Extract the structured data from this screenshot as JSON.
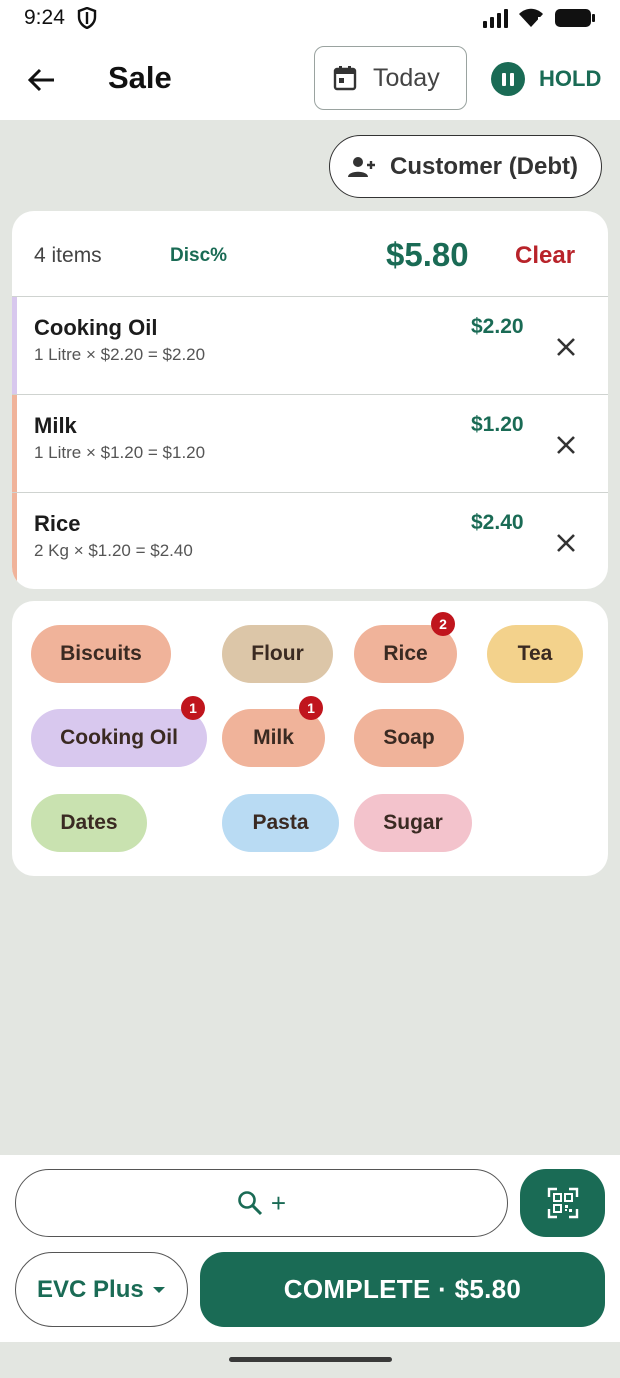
{
  "status_bar": {
    "time": "9:24"
  },
  "app_bar": {
    "title": "Sale",
    "date_filter": "Today",
    "hold_label": "HOLD"
  },
  "customer_button": "Customer (Debt)",
  "cart": {
    "items_count": "4 items",
    "discount_label": "Disc%",
    "total": "$5.80",
    "clear_label": "Clear",
    "items": [
      {
        "name": "Cooking Oil",
        "detail": "1 Litre × $2.20 = $2.20",
        "price": "$2.20",
        "stripe_color": "#d8c8ee"
      },
      {
        "name": "Milk",
        "detail": "1 Litre × $1.20 = $1.20",
        "price": "$1.20",
        "stripe_color": "#f0b39a"
      },
      {
        "name": "Rice",
        "detail": "2 Kg × $1.20 = $2.40",
        "price": "$2.40",
        "stripe_color": "#f0b39a"
      }
    ]
  },
  "products": [
    {
      "label": "Biscuits",
      "color": "#f0b39a",
      "badge": ""
    },
    {
      "label": "Flour",
      "color": "#dcc6a8",
      "badge": ""
    },
    {
      "label": "Rice",
      "color": "#f0b39a",
      "badge": "2"
    },
    {
      "label": "Tea",
      "color": "#f3d28c",
      "badge": ""
    },
    {
      "label": "Cooking Oil",
      "color": "#d8c8ee",
      "badge": "1"
    },
    {
      "label": "Milk",
      "color": "#f0b39a",
      "badge": "1"
    },
    {
      "label": "Soap",
      "color": "#f0b39a",
      "badge": ""
    },
    {
      "label": "Dates",
      "color": "#c9e2b0",
      "badge": ""
    },
    {
      "label": "Pasta",
      "color": "#b9dbf3",
      "badge": ""
    },
    {
      "label": "Sugar",
      "color": "#f3c3cc",
      "badge": ""
    }
  ],
  "bottom": {
    "search_plus": "+",
    "payment_method": "EVC Plus",
    "complete_label": "COMPLETE · $5.80"
  },
  "colors": {
    "primary": "#1a6b55",
    "danger": "#b8232a",
    "badge": "#c0151d",
    "background": "#e3e6e1"
  }
}
